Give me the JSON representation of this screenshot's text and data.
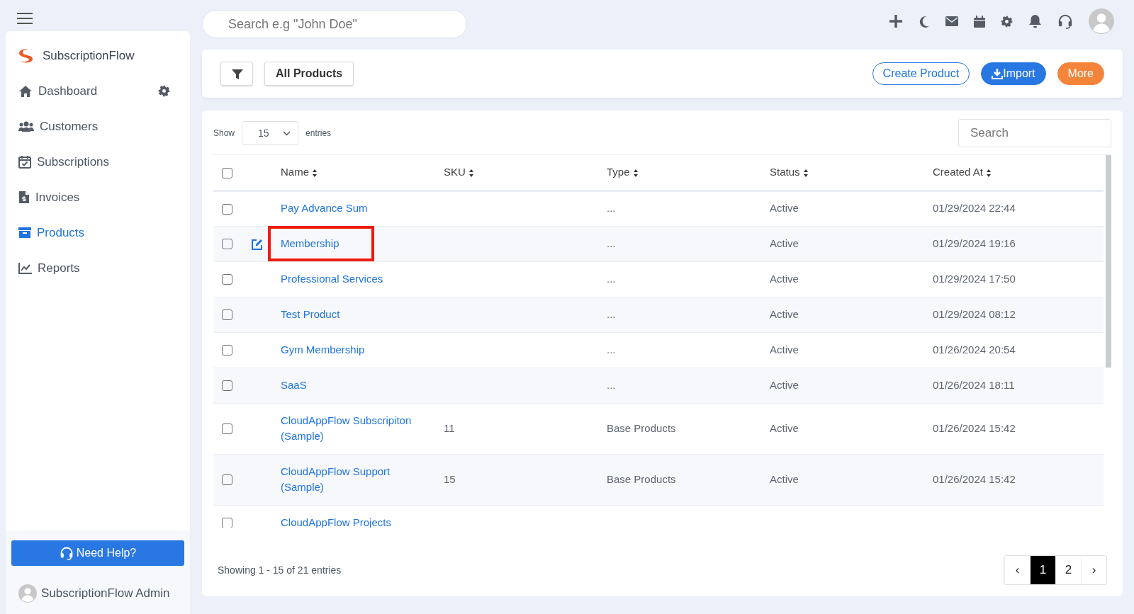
{
  "topbar": {
    "search_placeholder": "Search e.g \"John Doe\""
  },
  "sidebar": {
    "brand": "SubscriptionFlow",
    "items": [
      {
        "label": "Dashboard",
        "selected": false
      },
      {
        "label": "Customers",
        "selected": false
      },
      {
        "label": "Subscriptions",
        "selected": false
      },
      {
        "label": "Invoices",
        "selected": false
      },
      {
        "label": "Products",
        "selected": true
      },
      {
        "label": "Reports",
        "selected": false
      }
    ],
    "help_button": "Need Help?",
    "user": "SubscriptionFlow Admin"
  },
  "toolbar": {
    "view": "All Products",
    "buttons": [
      {
        "label": "Create Product",
        "kind": "outline"
      },
      {
        "label": "Import",
        "kind": "import"
      },
      {
        "label": "More",
        "kind": "more"
      }
    ]
  },
  "table": {
    "show_label": "Show",
    "page_size": "15",
    "entries_label": "entries",
    "search_placeholder": "Search",
    "select_all_checked": false,
    "columns": [
      "Name",
      "SKU",
      "Type",
      "Status",
      "Created At"
    ],
    "rows": [
      {
        "name": "Pay Advance Sum",
        "sku": "",
        "type": "...",
        "status": "Active",
        "created": "01/29/2024 22:44",
        "checked": false,
        "hovered": false,
        "highlighted": false
      },
      {
        "name": "Membership",
        "sku": "",
        "type": "...",
        "status": "Active",
        "created": "01/29/2024 19:16",
        "checked": false,
        "hovered": true,
        "highlighted": true
      },
      {
        "name": "Professional Services",
        "sku": "",
        "type": "...",
        "status": "Active",
        "created": "01/29/2024 17:50",
        "checked": false,
        "hovered": false,
        "highlighted": false
      },
      {
        "name": "Test Product",
        "sku": "",
        "type": "...",
        "status": "Active",
        "created": "01/29/2024 08:12",
        "checked": false,
        "hovered": false,
        "highlighted": false
      },
      {
        "name": "Gym Membership",
        "sku": "",
        "type": "...",
        "status": "Active",
        "created": "01/26/2024 20:54",
        "checked": false,
        "hovered": false,
        "highlighted": false
      },
      {
        "name": "SaaS",
        "sku": "",
        "type": "...",
        "status": "Active",
        "created": "01/26/2024 18:11",
        "checked": false,
        "hovered": false,
        "highlighted": false
      },
      {
        "name": "CloudAppFlow Subscripiton (Sample)",
        "sku": "11",
        "type": "Base Products",
        "status": "Active",
        "created": "01/26/2024 15:42",
        "checked": false,
        "hovered": false,
        "highlighted": false
      },
      {
        "name": "CloudAppFlow Support (Sample)",
        "sku": "15",
        "type": "Base Products",
        "status": "Active",
        "created": "01/26/2024 15:42",
        "checked": false,
        "hovered": false,
        "highlighted": false
      },
      {
        "name": "CloudAppFlow Projects",
        "sku": "",
        "type": "",
        "status": "",
        "created": "",
        "checked": false,
        "hovered": false,
        "highlighted": false
      }
    ],
    "info": "Showing 1 - 15 of 21 entries",
    "pages": [
      {
        "label": "‹",
        "selected": false
      },
      {
        "label": "1",
        "selected": true
      },
      {
        "label": "2",
        "selected": false
      },
      {
        "label": "›",
        "selected": false
      }
    ]
  }
}
